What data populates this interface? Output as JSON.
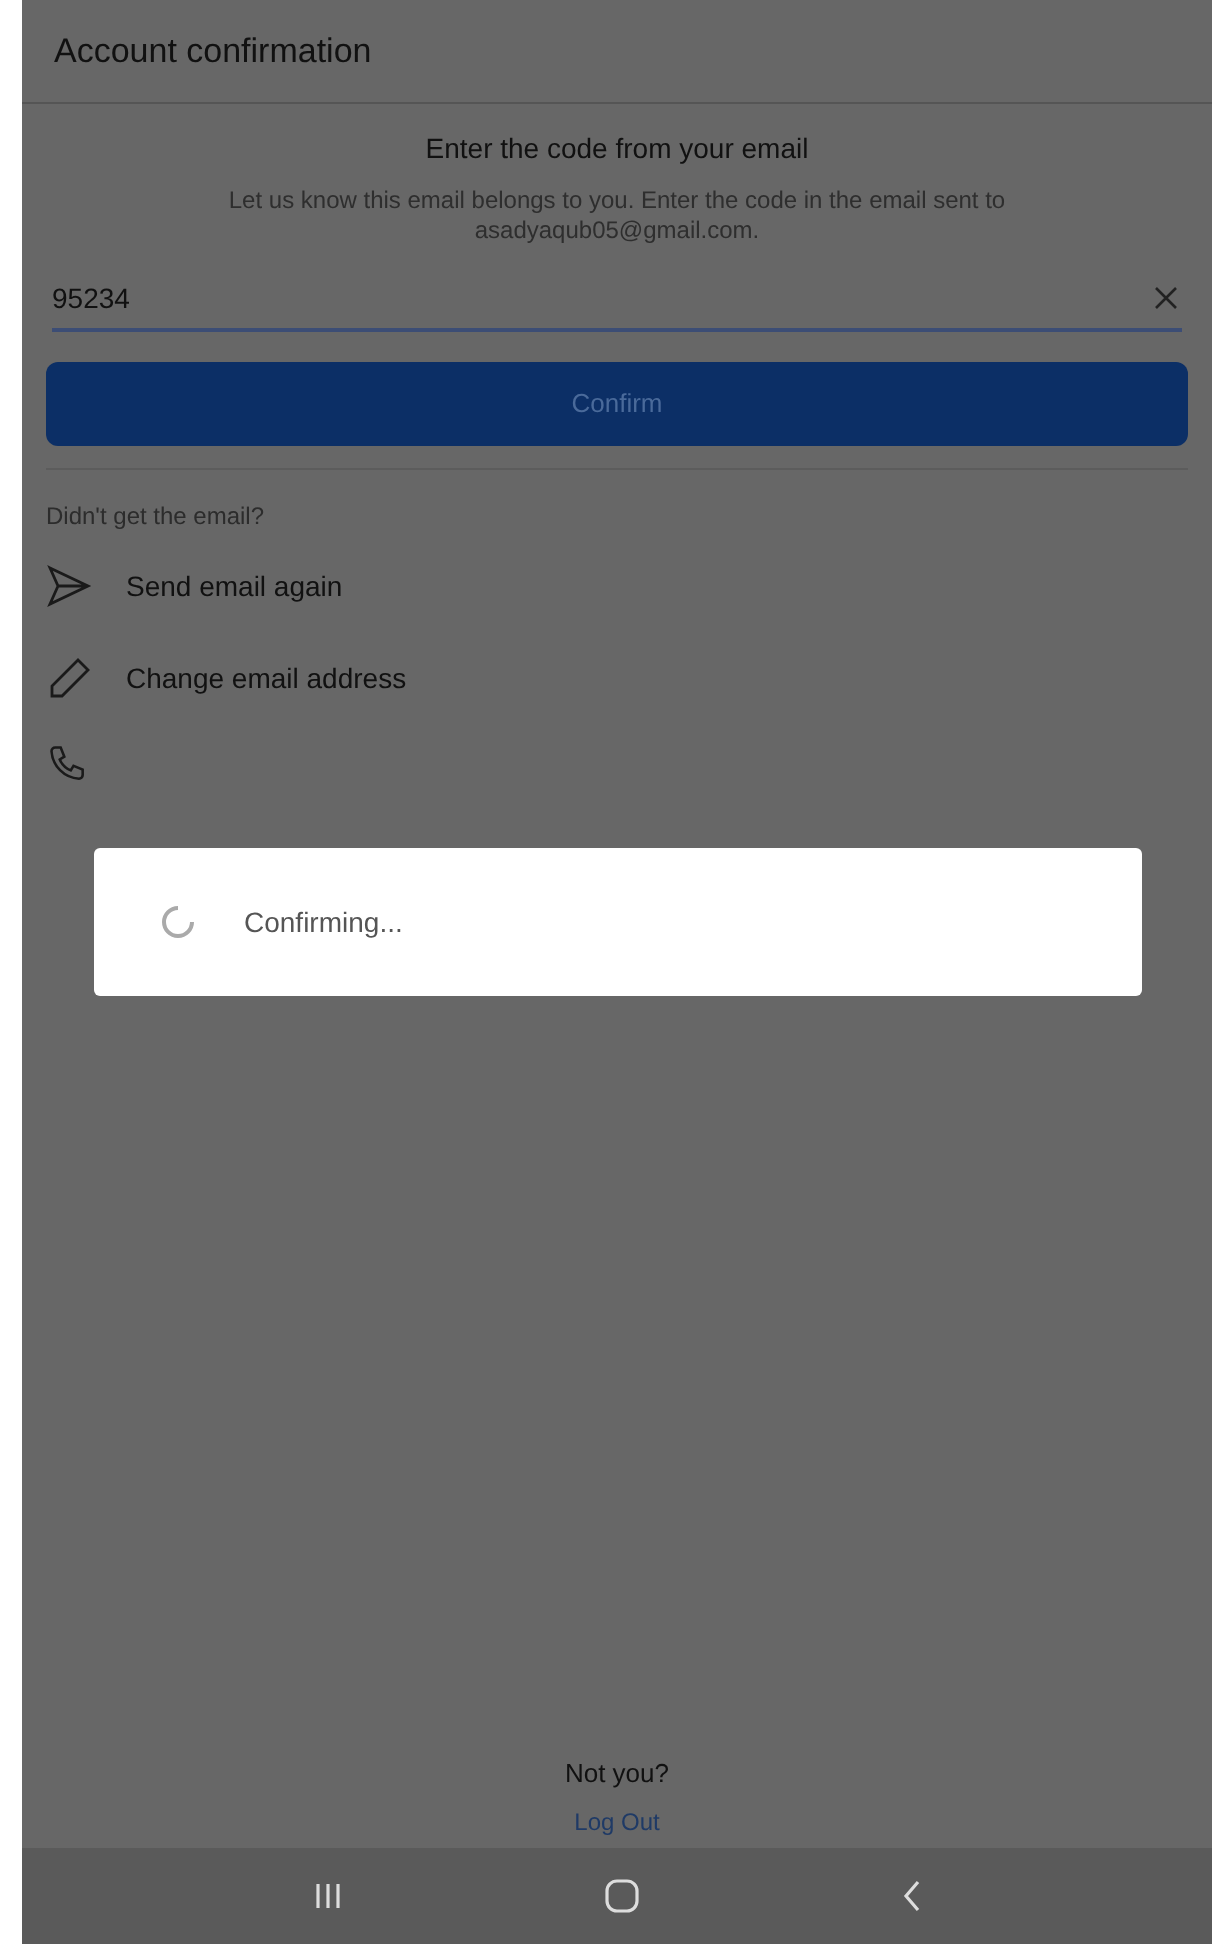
{
  "header": {
    "title": "Account confirmation"
  },
  "heading": "Enter the code from your email",
  "subtitle": "Let us know this email belongs to you. Enter the code in the email sent to asadyaqub05@gmail.com.",
  "code_field": {
    "value": "95234"
  },
  "confirm_button": "Confirm",
  "help_label": "Didn't get the email?",
  "options": [
    {
      "kind": "send",
      "label": "Send email again"
    },
    {
      "kind": "edit",
      "label": "Change email address"
    }
  ],
  "dialog": {
    "text": "Confirming..."
  },
  "footer": {
    "question": "Not you?",
    "link": "Log Out"
  }
}
